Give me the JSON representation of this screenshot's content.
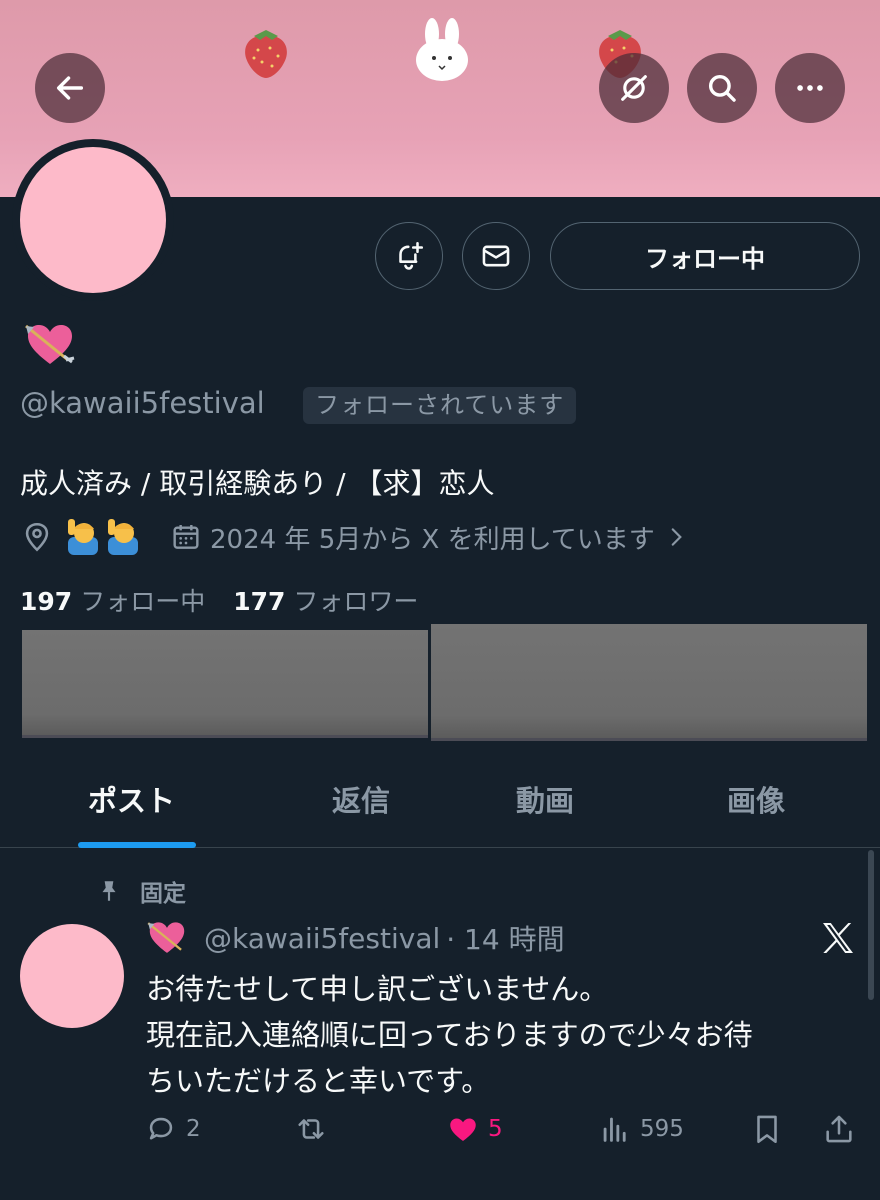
{
  "header": {
    "back_icon": "arrow-left-icon",
    "translate_icon": "no-translate-icon",
    "search_icon": "search-icon",
    "more_icon": "more-horizontal-icon",
    "banner_decor": [
      "strawberry",
      "bunny",
      "strawberry"
    ]
  },
  "profile": {
    "name_emoji": "heart-with-arrow",
    "handle": "@kawaii5festival",
    "follows_you": "フォローされています",
    "bio": "成人済み / 取引経験あり / 【求】恋人",
    "location_emoji": "man-raising-hand x2",
    "joined": "2024 年 5月から X を利用しています",
    "following_count": "197",
    "following_label": "フォロー中",
    "followers_count": "177",
    "followers_label": "フォロワー",
    "follow_button": "フォロー中",
    "colors": {
      "background": "#15202b",
      "accent": "#1d9bf0",
      "avatar": "#fdbac9"
    }
  },
  "tabs": [
    {
      "label": "ポスト",
      "active": true
    },
    {
      "label": "返信",
      "active": false
    },
    {
      "label": "動画",
      "active": false
    },
    {
      "label": "画像",
      "active": false
    }
  ],
  "post": {
    "pinned_label": "固定",
    "handle": "@kawaii5festival",
    "time": "· 14 時間",
    "lines": [
      "お待たせして申し訳ございません。",
      "現在記入連絡順に回っておりますので少々お待",
      "ちいただけると幸いです。"
    ],
    "replies": "2",
    "likes": "5",
    "views": "595",
    "liked": true
  }
}
